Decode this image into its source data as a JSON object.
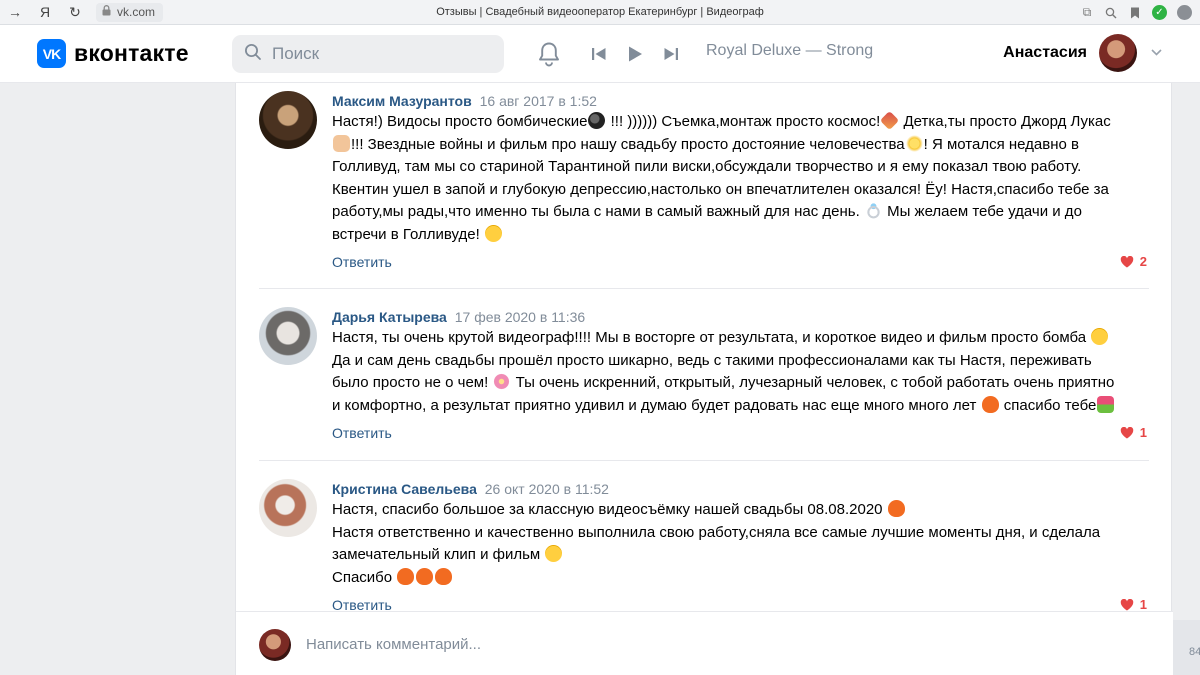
{
  "browser": {
    "address": "vk.com",
    "tab_title": "Отзывы | Свадебный видеооператор Екатеринбург | Видеограф"
  },
  "header": {
    "logo_text": "вконтакте",
    "search_placeholder": "Поиск",
    "now_playing": "Royal Deluxe — Strong",
    "user_name": "Анастасия"
  },
  "comments": [
    {
      "author": "Максим Мазурантов",
      "date": "16 авг 2017 в 1:52",
      "text": "Настя!) Видосы просто бомбические!!! )))))) Съемка,монтаж просто космос! Детка,ты просто Джорд Лукас !!! Звездные войны и фильм про нашу свадьбу просто достояние человечества! Я мотался недавно в Голливуд, там мы со стариной Тарантиной пили виски,обсуждали творчество и я ему показал твою работу. Квентин ушел в запой и глубокую депрессию,настолько он впечатлителен оказался! Ёу! Настя,спасибо тебе за работу,мы рады,что именно ты была с нами в самый важный для нас день. Мы желаем тебе удачи и до встречи в Голливуде!",
      "lines": [
        "Настя!) Видосы просто бомбические",
        " !!! )))))) Съемка,монтаж просто космос!",
        " Детка,ты просто Джорд Лукас",
        "!!! Звездные войны и фильм про нашу свадьбу просто достояние человечества",
        "! Я мотался недавно в",
        "Голливуд, там мы со стариной Тарантиной пили виски,обсуждали творчество и я ему показал твою работу.",
        "Квентин ушел в запой и глубокую депрессию,настолько он впечатлителен оказался! Ёу! Настя,спасибо тебе за",
        "работу,мы рады,что именно ты была с нами в самый важный для нас день.",
        " Мы желаем тебе удачи и до",
        "встречи в Голливуде! "
      ],
      "reply_label": "Ответить",
      "likes": "2"
    },
    {
      "author": "Дарья Катырева",
      "date": "17 фев 2020 в 11:36",
      "lines": [
        "Настя, ты очень крутой видеограф!!!! Мы в восторге от результата, и короткое видео и фильм просто бомба",
        "Да и сам день свадьбы прошёл просто шикарно, ведь с такими профессионалами как ты Настя, переживать",
        "было просто не о чем!",
        " Ты очень искренний, открытый, лучезарный человек, с тобой работать очень приятно",
        "и комфортно, а результат приятно удивил и думаю будет радовать нас еще много много лет",
        " спасибо тебе"
      ],
      "reply_label": "Ответить",
      "likes": "1"
    },
    {
      "author": "Кристина Савельева",
      "date": "26 окт 2020 в 11:52",
      "lines": [
        "Настя, спасибо большое за классную видеосъёмку нашей свадьбы 08.08.2020",
        "Настя ответственно и качественно выполнила свою работу,сняла все самые лучшие моменты дня, и сделала",
        "замечательный клип и фильм",
        "Спасибо"
      ],
      "reply_label": "Ответить",
      "likes": "1"
    }
  ],
  "compose": {
    "placeholder": "Написать комментарий..."
  },
  "side_fragment": "84"
}
